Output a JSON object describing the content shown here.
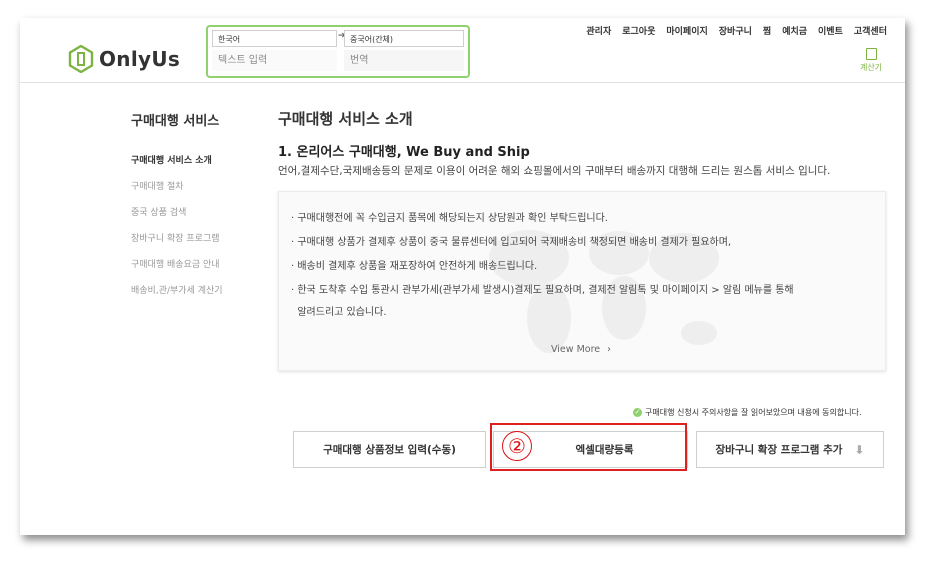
{
  "header": {
    "logo_text": "OnlyUs",
    "translator": {
      "source_lang": "한국어",
      "target_lang": "중국어(간체)",
      "input_placeholder": "텍스트 입력",
      "output_placeholder": "번역"
    },
    "nav": [
      "관리자",
      "로그아웃",
      "마이페이지",
      "장바구니",
      "찜",
      "예치금",
      "이벤트",
      "고객센터"
    ],
    "calculator_label": "계산기"
  },
  "sidebar": {
    "title": "구매대행 서비스",
    "items": [
      {
        "label": "구매대행 서비스 소개",
        "active": true
      },
      {
        "label": "구매대행 절차",
        "active": false
      },
      {
        "label": "중국 상품 검색",
        "active": false
      },
      {
        "label": "장바구니 확장 프로그램",
        "active": false
      },
      {
        "label": "구매대행 배송요금 안내",
        "active": false
      },
      {
        "label": "배송비,관/부가세 계산기",
        "active": false
      }
    ]
  },
  "main": {
    "title": "구매대행 서비스 소개",
    "section_title": "1. 온리어스 구매대행, We Buy and Ship",
    "description": "언어,결제수단,국제배송등의 문제로 이용이 어려운 해외 쇼핑몰에서의 구매부터 배송까지 대행해 드리는 원스톱 서비스 입니다.",
    "notices": [
      "· 구매대행전에 꼭 수입금지 품목에 해당되는지 상담원과 확인 부탁드립니다.",
      "· 구매대행 상품가 결제후 상품이 중국 물류센터에 입고되어 국제배송비 책정되면 배송비 결제가 필요하며,",
      "· 배송비 결제후 상품을 재포장하여 안전하게 배송드립니다.",
      "· 한국 도착후 수입 통관시 관부가세(관부가세 발생시)결제도 필요하며, 결제전 알림톡 및 마이페이지 > 알림 메뉴를 통해",
      "  알려드리고 있습니다."
    ],
    "view_more": "View More",
    "consent": "구매대행 신청시 주의사항을 잘 읽어보았으며 내용에 동의합니다.",
    "buttons": {
      "manual": "구매대행 상품정보 입력(수동)",
      "excel": "엑셀대량등록",
      "extension": "장바구니 확장 프로그램 추가"
    },
    "step_marker": "②"
  },
  "colors": {
    "accent_green": "#8fd16f",
    "highlight_red": "#e02020"
  }
}
